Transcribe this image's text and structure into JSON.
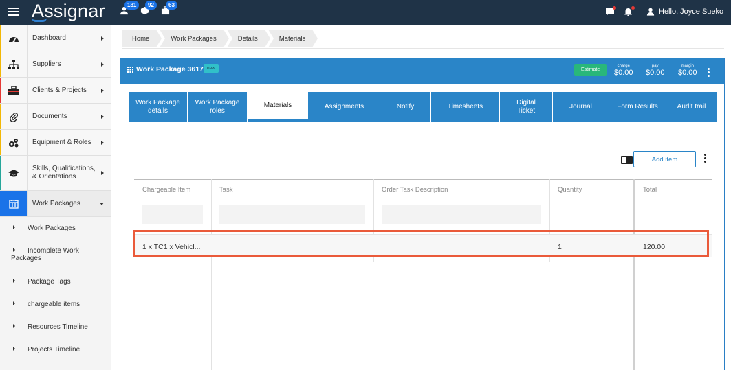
{
  "app": {
    "logo": "Assignar",
    "badges": {
      "people": "181",
      "packages": "92",
      "jobs": "63"
    },
    "user_greeting": "Hello, Joyce Sueko",
    "accent_color": "#2a85c8",
    "topbar_color": "#1f3347"
  },
  "sidebar": {
    "items": [
      {
        "label": "Dashboard",
        "icon": "dashboard-gauge-icon"
      },
      {
        "label": "Suppliers",
        "icon": "org-chart-icon"
      },
      {
        "label": "Clients & Projects",
        "icon": "briefcase-icon"
      },
      {
        "label": "Documents",
        "icon": "paperclip-icon"
      },
      {
        "label": "Equipment & Roles",
        "icon": "gears-icon"
      },
      {
        "label": "Skills, Qualifications, & Orientations",
        "icon": "graduation-cap-icon"
      },
      {
        "label": "Work Packages",
        "icon": "calendar-icon"
      }
    ],
    "sub_items": [
      {
        "label": "Work Packages"
      },
      {
        "label": "Incomplete Work Packages"
      },
      {
        "label": "Package Tags"
      },
      {
        "label": "chargeable items"
      },
      {
        "label": "Resources Timeline"
      },
      {
        "label": "Projects Timeline"
      }
    ]
  },
  "breadcrumb": [
    "Home",
    "Work Packages",
    "Details",
    "Materials"
  ],
  "panel": {
    "title": "Work Package 3617",
    "status_badge": "new",
    "estimate_label": "Estimate",
    "stats": [
      {
        "label": "charge",
        "value": "$0.00"
      },
      {
        "label": "pay",
        "value": "$0.00"
      },
      {
        "label": "margin",
        "value": "$0.00"
      }
    ]
  },
  "tabs": [
    {
      "label": "Work Package details"
    },
    {
      "label": "Work Package roles"
    },
    {
      "label": "Materials"
    },
    {
      "label": "Assignments"
    },
    {
      "label": "Notify"
    },
    {
      "label": "Timesheets"
    },
    {
      "label": "Digital Ticket"
    },
    {
      "label": "Journal"
    },
    {
      "label": "Form Results"
    },
    {
      "label": "Audit trail"
    }
  ],
  "materials": {
    "add_item_label": "Add item",
    "columns": [
      "Chargeable Item",
      "Task",
      "Order Task Description",
      "Quantity",
      "Total"
    ],
    "rows": [
      {
        "item": "1 x TC1 x Vehicl...",
        "task": "",
        "description": "",
        "quantity": "1",
        "total": "120.00"
      }
    ]
  }
}
